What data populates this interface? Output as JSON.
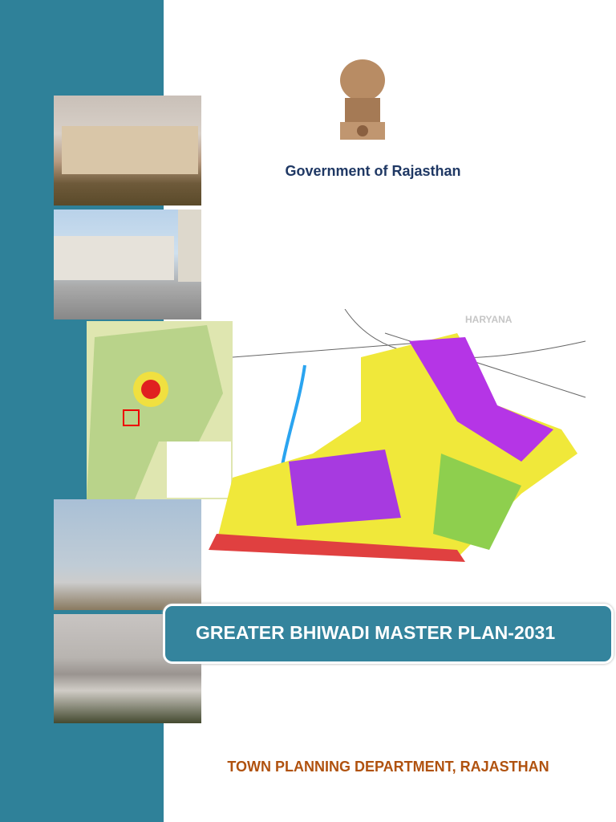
{
  "header": {
    "government": "Government of Rajasthan"
  },
  "title": "GREATER BHIWADI MASTER PLAN-2031",
  "footer": "TOWN PLANNING DEPARTMENT, RAJASTHAN",
  "map": {
    "label_state": "HARYANA"
  },
  "colors": {
    "sidebar": "#2f8199",
    "title_box": "#34849d",
    "gov_text": "#1f3864",
    "footer_text": "#b0520f"
  }
}
